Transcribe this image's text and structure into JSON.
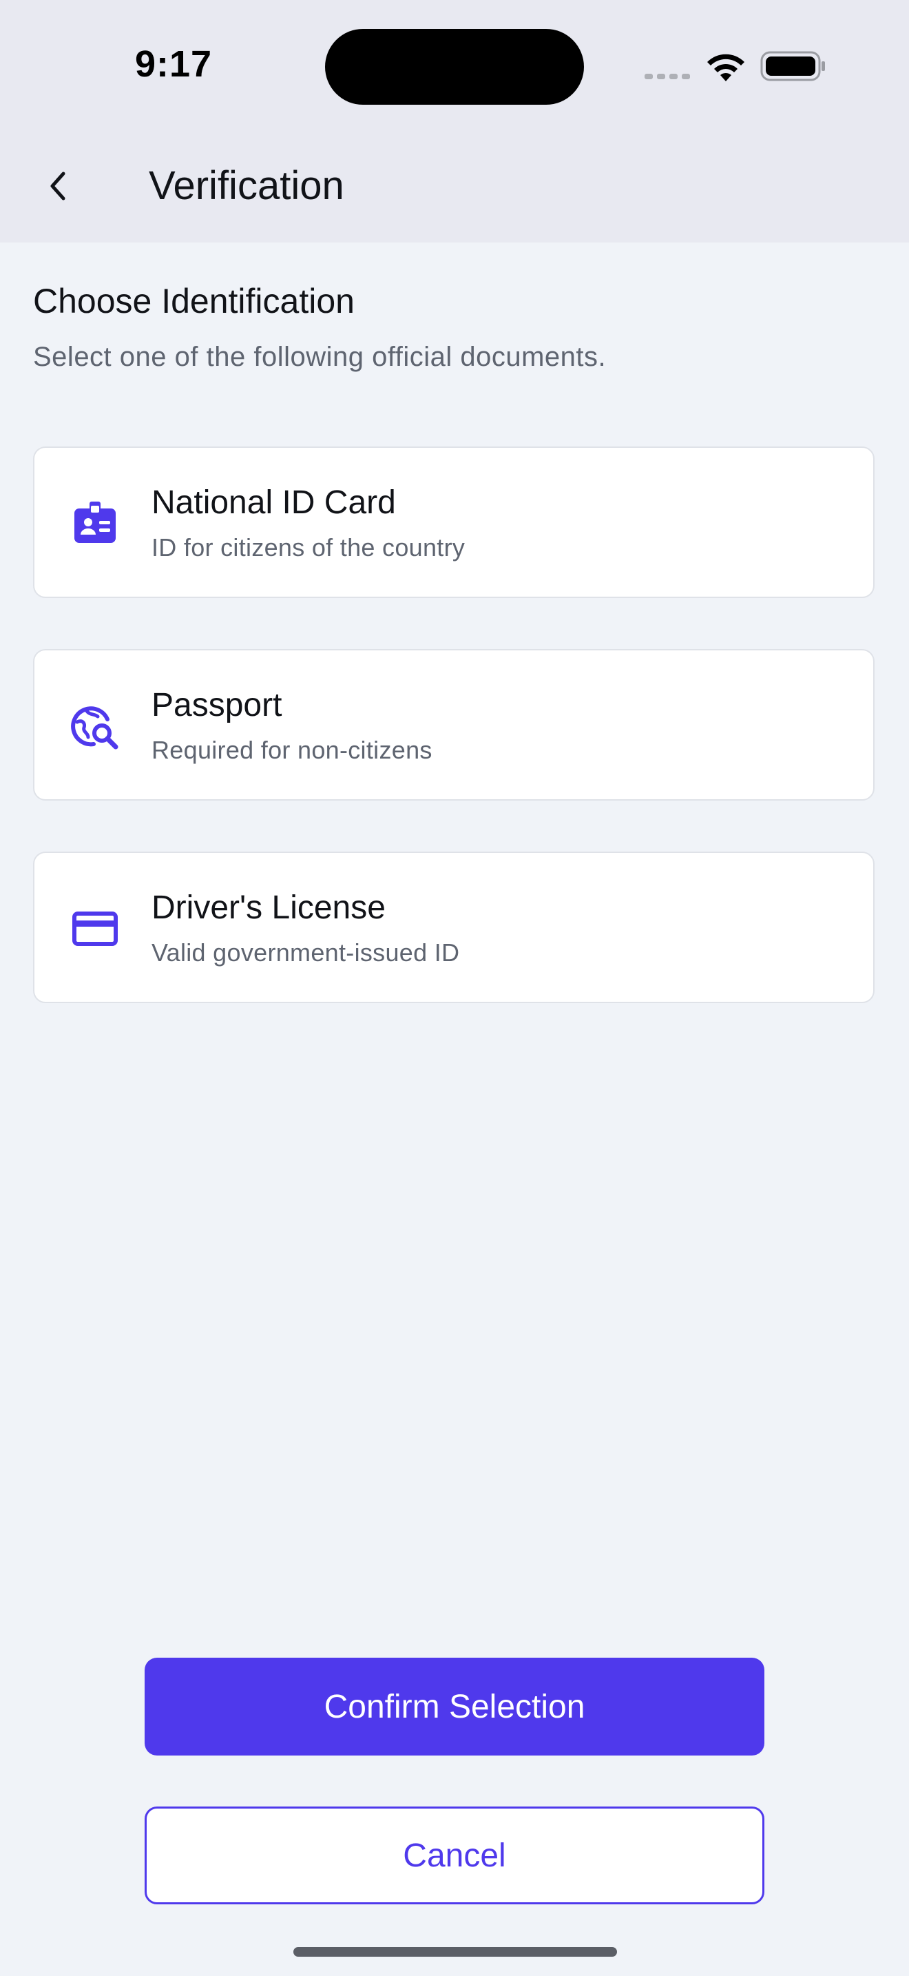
{
  "status_bar": {
    "time": "9:17"
  },
  "header": {
    "title": "Verification",
    "back_icon": "chevron-left-icon"
  },
  "intro": {
    "title": "Choose Identification",
    "subtitle": "Select one of the following official documents."
  },
  "options": [
    {
      "title": "National ID Card",
      "description": "ID for citizens of the country",
      "icon": "id-badge-icon"
    },
    {
      "title": "Passport",
      "description": "Required for non-citizens",
      "icon": "globe-search-icon"
    },
    {
      "title": "Driver's License",
      "description": "Valid government-issued ID",
      "icon": "credit-card-icon"
    }
  ],
  "actions": {
    "confirm_label": "Confirm Selection",
    "cancel_label": "Cancel"
  },
  "colors": {
    "accent": "#4F39EC",
    "header_bg": "#E8E9F1",
    "page_bg": "#F0F3F8",
    "card_border": "#DFE2E8"
  }
}
